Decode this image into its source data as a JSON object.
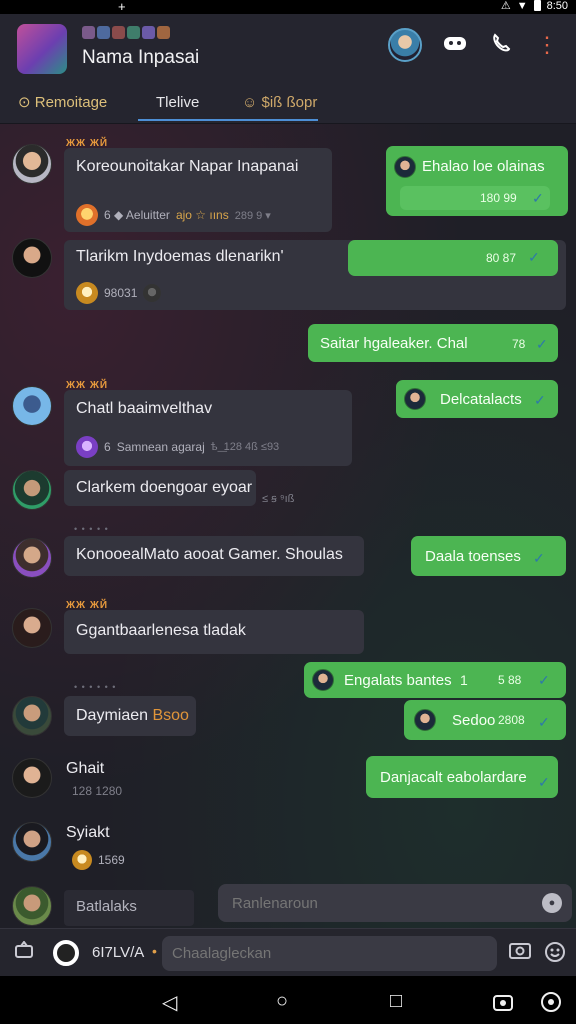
{
  "status_bar": {
    "left_icon": "+",
    "time": "8:50"
  },
  "header": {
    "title": "Nama Inpasai",
    "icons": [
      "group-avatar",
      "profile-avatar",
      "game-controller-icon",
      "phone-icon",
      "more-icon"
    ]
  },
  "tabs": [
    {
      "label": "⊙ Remoitage"
    },
    {
      "label": "Tlelive"
    },
    {
      "label": "☺ $iß ßopr"
    }
  ],
  "messages": {
    "m1": {
      "tag": "ЖЖ ЖЙ",
      "text": "Koreounoitakar Napar Inapanai",
      "meta1": "6 ◆ Aeluitter",
      "meta2": "ajo ☆ ııns",
      "meta3": "289 9 ▾"
    },
    "m2": {
      "text": "Tlarikm Inydoemas dlenarikn'",
      "meta": "98031"
    },
    "o1": {
      "text": "Ehalao loe olainas",
      "time": "180 99",
      "check": "✓"
    },
    "o2": {
      "time": "80 87",
      "check": "✓"
    },
    "o3": {
      "text": "Saitar hgaleaker. Chal",
      "time": "78",
      "check": "✓"
    },
    "m3": {
      "tag": "ЖЖ ЖЙ",
      "text": "Chatl baaimvelthav",
      "meta1": "6",
      "meta2": "Samnean agaraj",
      "meta3": "ѣ ͟ 128 4ß ≤93"
    },
    "o4": {
      "text": "Delcatalacts",
      "check": "✓"
    },
    "m4": {
      "text": "Clarkem doengoar eyoar",
      "meta": "≤ ꞩ ⁹ıß"
    },
    "m5": {
      "text": "KonooealMato aooat Gamer. Shoulas"
    },
    "o5": {
      "text": "Daala toenses",
      "check": "✓"
    },
    "m6": {
      "tag": "ЖЖ ЖЙ",
      "text": "Ggantbaarlenesa tladak"
    },
    "o6": {
      "text": "Engalats bantes",
      "time": "1",
      "time2": "5 88",
      "check": "✓"
    },
    "m7": {
      "text": "Daymiaen",
      "highlight": "Bsoo"
    },
    "o7": {
      "text": "Sedoo",
      "time": "2808",
      "check": "✓"
    },
    "m8": {
      "name": "Ghait",
      "meta": "128 1280"
    },
    "o8": {
      "text": "Danjacalt eabolardare",
      "check": "✓"
    },
    "m9": {
      "name": "Syiakt",
      "meta": "1569"
    },
    "m10": {
      "text": "Batlalaks"
    }
  },
  "reply_input": {
    "placeholder": "Ranlenaroun"
  },
  "bottom_bar": {
    "label": "6I7LV/A",
    "arrow": "•",
    "input_placeholder": "Chaalagleckan"
  },
  "nav": {
    "back": "◁",
    "home": "○",
    "recents": "□"
  }
}
